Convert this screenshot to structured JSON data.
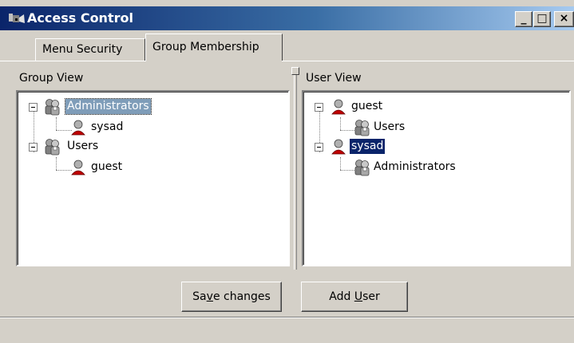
{
  "window": {
    "title": "Access Control",
    "minimize": "_",
    "maximize": "□",
    "close": "×"
  },
  "tabs": [
    {
      "label": "Menu Security",
      "active": false
    },
    {
      "label": "Group Membership",
      "active": true
    }
  ],
  "group_view": {
    "label": "Group View",
    "nodes": [
      {
        "label": "Administrators",
        "type": "group",
        "level": 0,
        "selected": true
      },
      {
        "label": "sysad",
        "type": "user",
        "level": 1
      },
      {
        "label": "Users",
        "type": "group",
        "level": 0
      },
      {
        "label": "guest",
        "type": "user",
        "level": 1
      }
    ]
  },
  "user_view": {
    "label": "User View",
    "nodes": [
      {
        "label": "guest",
        "type": "user",
        "level": 0
      },
      {
        "label": "Users",
        "type": "group",
        "level": 1
      },
      {
        "label": "sysad",
        "type": "user",
        "level": 0,
        "selected": true
      },
      {
        "label": "Administrators",
        "type": "group",
        "level": 1
      }
    ]
  },
  "buttons": {
    "save_pre": "Sa",
    "save_key": "v",
    "save_post": "e changes",
    "add_pre": "Add ",
    "add_key": "U",
    "add_post": "ser"
  },
  "colors": {
    "title_start": "#0a246a",
    "title_end": "#a6caf0",
    "face": "#d4d0c8",
    "selection": "#0a246a"
  }
}
